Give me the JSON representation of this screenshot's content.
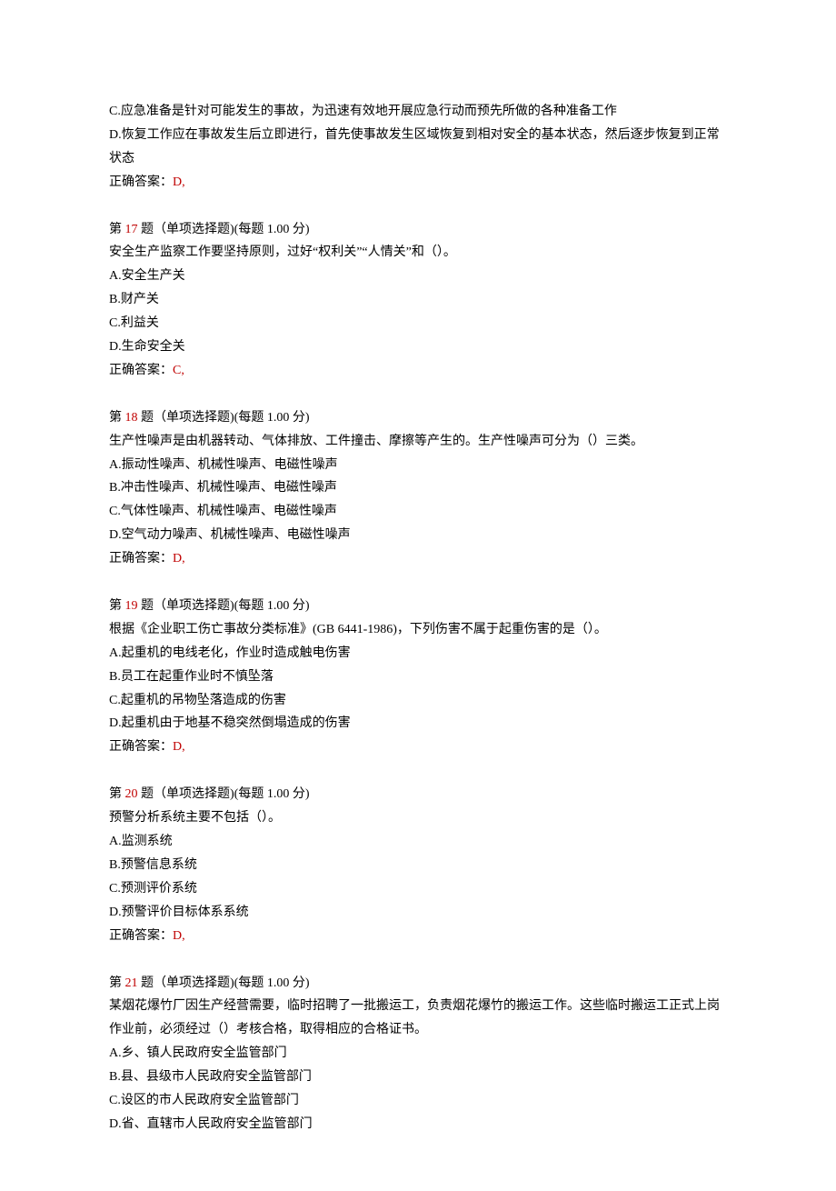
{
  "partial_q": {
    "option_c": "C.应急准备是针对可能发生的事故，为迅速有效地开展应急行动而预先所做的各种准备工作",
    "option_d": "D.恢复工作应在事故发生后立即进行，首先使事故发生区域恢复到相对安全的基本状态，然后逐步恢复到正常状态",
    "answer_label": "正确答案：",
    "answer_value": "D,"
  },
  "questions": [
    {
      "prefix": "第 ",
      "num": "17",
      "suffix": " 题（单项选择题)(每题 1.00 分)",
      "stem": "安全生产监察工作要坚持原则，过好“权利关”“人情关”和（）。",
      "options": [
        "A.安全生产关",
        "B.财产关",
        "C.利益关",
        "D.生命安全关"
      ],
      "answer_label": "正确答案：",
      "answer_value": "C,"
    },
    {
      "prefix": "第 ",
      "num": "18",
      "suffix": " 题（单项选择题)(每题 1.00 分)",
      "stem": "生产性噪声是由机器转动、气体排放、工件撞击、摩擦等产生的。生产性噪声可分为（）三类。",
      "options": [
        "A.振动性噪声、机械性噪声、电磁性噪声",
        "B.冲击性噪声、机械性噪声、电磁性噪声",
        "C.气体性噪声、机械性噪声、电磁性噪声",
        "D.空气动力噪声、机械性噪声、电磁性噪声"
      ],
      "answer_label": "正确答案：",
      "answer_value": "D,"
    },
    {
      "prefix": "第 ",
      "num": "19",
      "suffix": " 题（单项选择题)(每题 1.00 分)",
      "stem": "根据《企业职工伤亡事故分类标准》(GB  6441-1986)，下列伤害不属于起重伤害的是（）。",
      "options": [
        "A.起重机的电线老化，作业时造成触电伤害",
        "B.员工在起重作业时不慎坠落",
        "C.起重机的吊物坠落造成的伤害",
        "D.起重机由于地基不稳突然倒塌造成的伤害"
      ],
      "answer_label": "正确答案：",
      "answer_value": "D,"
    },
    {
      "prefix": "第 ",
      "num": "20",
      "suffix": " 题（单项选择题)(每题 1.00 分)",
      "stem": "预警分析系统主要不包括（）。",
      "options": [
        "A.监测系统",
        "B.预警信息系统",
        "C.预测评价系统",
        "D.预警评价目标体系系统"
      ],
      "answer_label": "正确答案：",
      "answer_value": "D,"
    },
    {
      "prefix": "第 ",
      "num": "21",
      "suffix": " 题（单项选择题)(每题 1.00 分)",
      "stem": "某烟花爆竹厂因生产经营需要，临时招聘了一批搬运工，负责烟花爆竹的搬运工作。这些临时搬运工正式上岗作业前，必须经过（）考核合格，取得相应的合格证书。",
      "options": [
        "A.乡、镇人民政府安全监管部门",
        "B.县、县级市人民政府安全监管部门",
        "C.设区的市人民政府安全监管部门",
        "D.省、直辖市人民政府安全监管部门"
      ],
      "answer_label": "",
      "answer_value": ""
    }
  ]
}
